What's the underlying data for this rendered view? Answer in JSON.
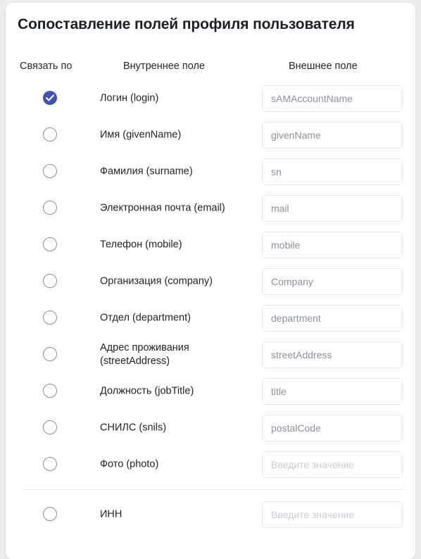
{
  "page": {
    "background_color": "#eceded",
    "card_background": "#ffffff",
    "accent_color": "#3f51b5"
  },
  "card": {
    "title": "Сопоставление полей профиля пользователя"
  },
  "headers": {
    "link_by": "Связать по",
    "internal_field": "Внутреннее поле",
    "external_field": "Внешнее поле"
  },
  "placeholder_default": "Введите значение",
  "rows": [
    {
      "label": "Логин (login)",
      "value": "sAMAccountName",
      "placeholder": "Введите значение",
      "selected": true
    },
    {
      "label": "Имя (givenName)",
      "value": "givenName",
      "placeholder": "Введите значение",
      "selected": false
    },
    {
      "label": "Фамилия (surname)",
      "value": "sn",
      "placeholder": "Введите значение",
      "selected": false
    },
    {
      "label": "Электронная почта (email)",
      "value": "mail",
      "placeholder": "Введите значение",
      "selected": false
    },
    {
      "label": "Телефон (mobile)",
      "value": "mobile",
      "placeholder": "Введите значение",
      "selected": false
    },
    {
      "label": "Организация (company)",
      "value": "Company",
      "placeholder": "Введите значение",
      "selected": false
    },
    {
      "label": "Отдел (department)",
      "value": "department",
      "placeholder": "Введите значение",
      "selected": false
    },
    {
      "label": "Адрес проживания (streetAddress)",
      "value": "streetAddress",
      "placeholder": "Введите значение",
      "selected": false
    },
    {
      "label": "Должность (jobTitle)",
      "value": "title",
      "placeholder": "Введите значение",
      "selected": false
    },
    {
      "label": "СНИЛС (snils)",
      "value": "postalCode",
      "placeholder": "Введите значение",
      "selected": false
    },
    {
      "label": "Фото (photo)",
      "value": "",
      "placeholder": "Введите значение",
      "selected": false
    }
  ],
  "extra_rows": [
    {
      "label": "ИНН",
      "value": "",
      "placeholder": "Введите значение",
      "selected": false
    }
  ]
}
